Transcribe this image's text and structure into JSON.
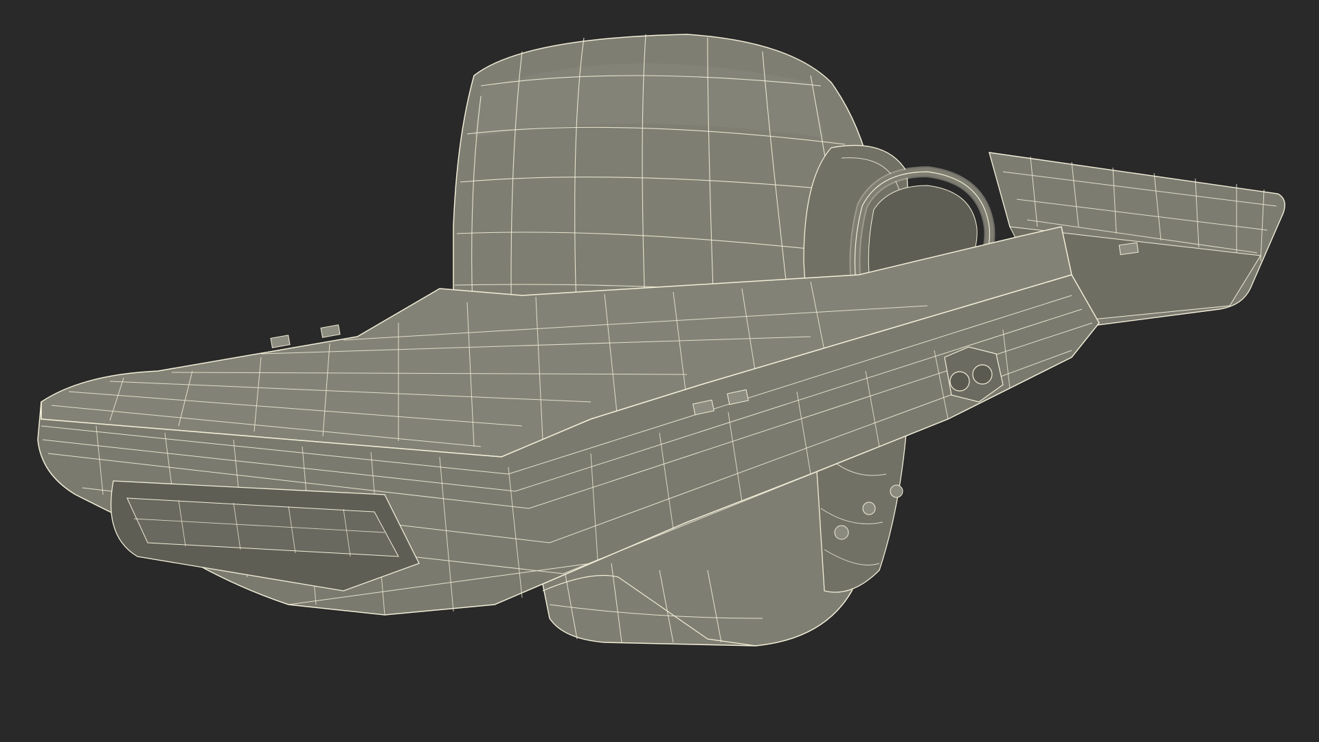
{
  "scene": {
    "background_color": "#292929",
    "mesh_fill": "#807f73",
    "mesh_fill_dark": "#6e6d62",
    "mesh_fill_light": "#8c8b80",
    "wire_color": "#f3efd9",
    "shadow_color": "#55544b"
  }
}
